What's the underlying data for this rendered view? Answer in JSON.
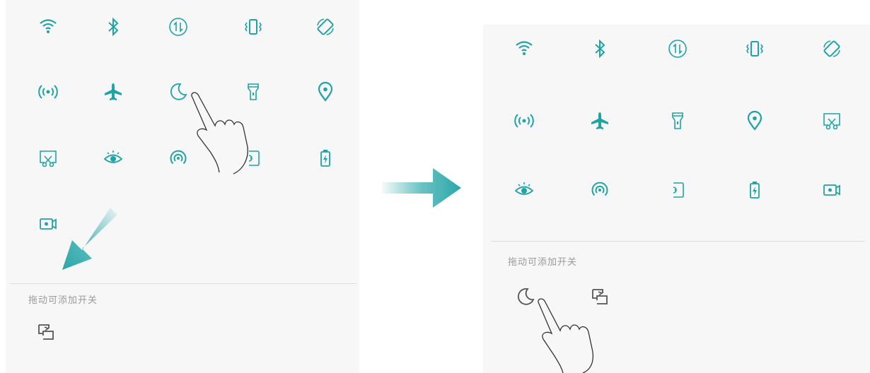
{
  "colors": {
    "accent": "#1fa3a6",
    "inactive": "#555555",
    "arrow": "#2aa7a9"
  },
  "left_panel": {
    "active_tiles": [
      "wifi-icon",
      "bluetooth-icon",
      "mobile-data-icon",
      "vibrate-icon",
      "auto-rotate-icon",
      "hotspot-icon",
      "airplane-mode-icon",
      "do-not-disturb-moon-icon",
      "flashlight-icon",
      "location-icon",
      "screenshot-icon",
      "eye-comfort-icon",
      "nfc-icon",
      "huawei-share-icon",
      "power-saving-icon",
      "screen-recorder-icon"
    ],
    "drag_section_label": "拖动可添加开关",
    "inactive_tiles": [
      "multi-screen-icon"
    ]
  },
  "right_panel": {
    "active_tiles": [
      "wifi-icon",
      "bluetooth-icon",
      "mobile-data-icon",
      "vibrate-icon",
      "auto-rotate-icon",
      "hotspot-icon",
      "airplane-mode-icon",
      "flashlight-icon",
      "location-icon",
      "screenshot-icon",
      "eye-comfort-icon",
      "nfc-icon",
      "huawei-share-icon",
      "power-saving-icon",
      "screen-recorder-icon"
    ],
    "drag_section_label": "拖动可添加开关",
    "inactive_tiles": [
      "do-not-disturb-moon-icon",
      "multi-screen-icon"
    ]
  }
}
